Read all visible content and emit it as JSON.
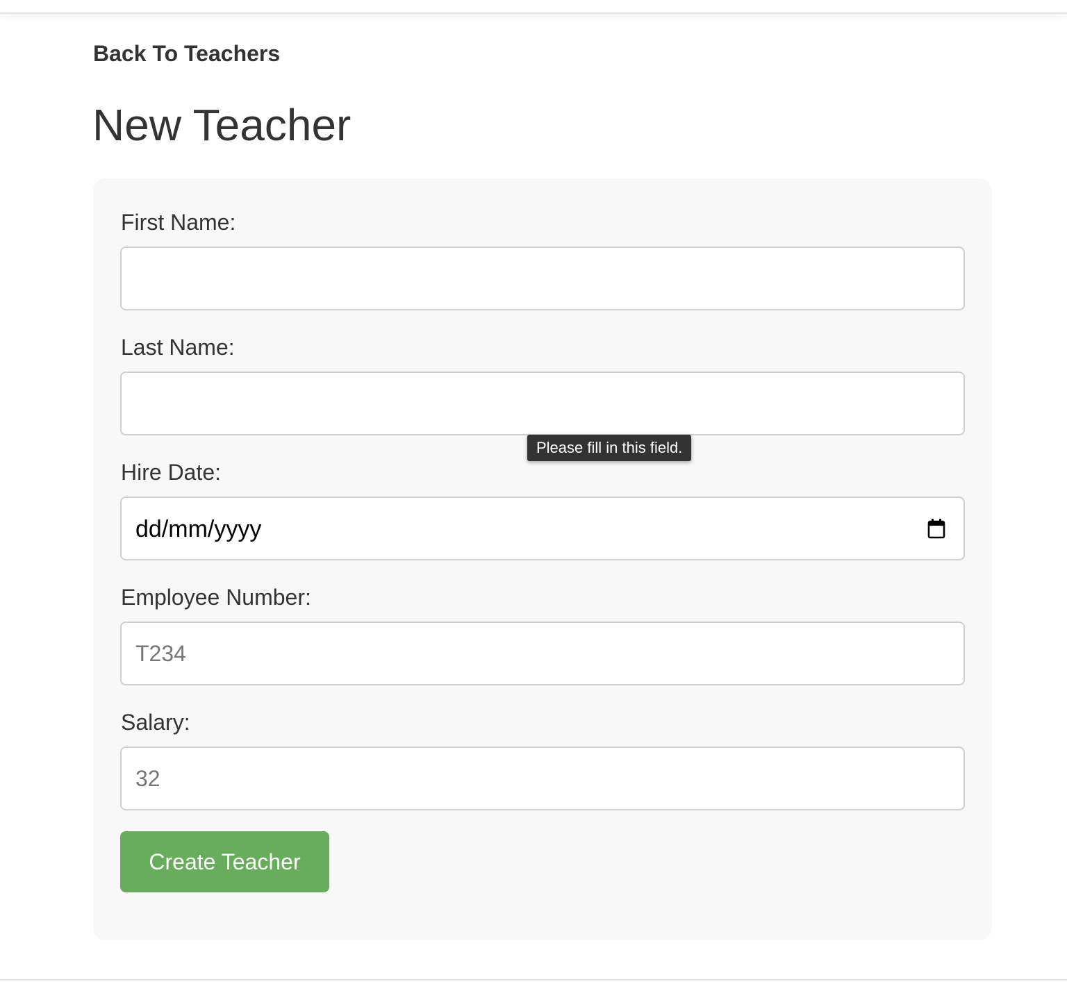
{
  "nav": {
    "back_label": "Back To Teachers"
  },
  "page": {
    "title": "New Teacher"
  },
  "form": {
    "first_name": {
      "label": "First Name:",
      "value": "",
      "placeholder": ""
    },
    "last_name": {
      "label": "Last Name:",
      "value": "",
      "placeholder": ""
    },
    "hire_date": {
      "label": "Hire Date:",
      "display": "dd/mm/yyyy",
      "icon": "calendar-icon"
    },
    "employee_number": {
      "label": "Employee Number:",
      "value": "",
      "placeholder": "T234"
    },
    "salary": {
      "label": "Salary:",
      "value": "",
      "placeholder": "32"
    },
    "submit_label": "Create Teacher"
  },
  "validation": {
    "tooltip": "Please fill in this field."
  },
  "colors": {
    "primary_button": "#67ad5b",
    "panel_background": "#f8f8f8",
    "text": "#333333",
    "tooltip_background": "#333333"
  }
}
